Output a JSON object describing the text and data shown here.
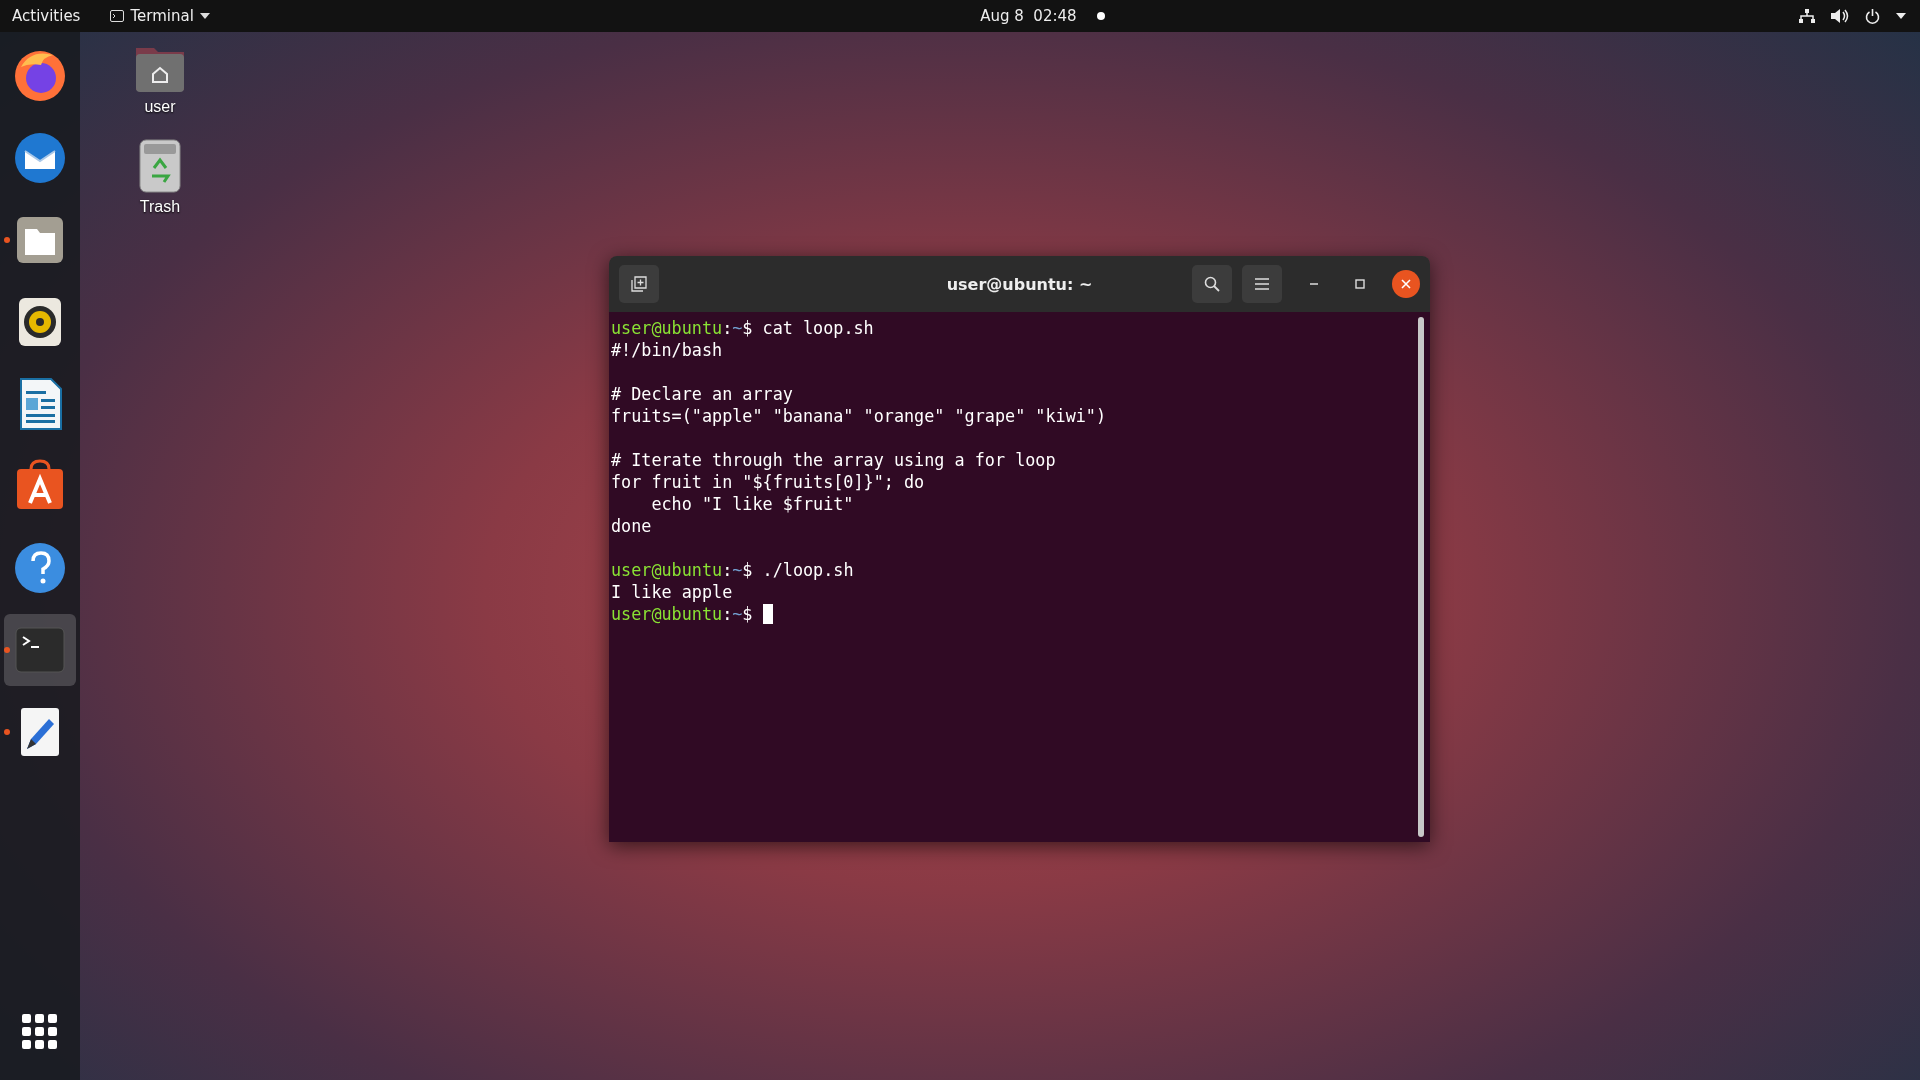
{
  "top_bar": {
    "activities": "Activities",
    "app_menu": "Terminal",
    "clock": "Aug 8  02:48",
    "recording": true
  },
  "dock": {
    "items": [
      {
        "kind": "browser",
        "running": false,
        "selected": false
      },
      {
        "kind": "mail",
        "running": false,
        "selected": false
      },
      {
        "kind": "files",
        "running": true,
        "selected": false
      },
      {
        "kind": "music",
        "running": false,
        "selected": false
      },
      {
        "kind": "document",
        "running": false,
        "selected": false
      },
      {
        "kind": "store",
        "running": false,
        "selected": false
      },
      {
        "kind": "help",
        "running": false,
        "selected": false
      },
      {
        "kind": "terminal",
        "running": true,
        "selected": true
      },
      {
        "kind": "editor",
        "running": true,
        "selected": false
      }
    ]
  },
  "desktop_icons": [
    {
      "kind": "home",
      "label": "user"
    },
    {
      "kind": "trash",
      "label": "Trash"
    }
  ],
  "terminal": {
    "title": "user@ubuntu: ~",
    "lines": [
      {
        "kind": "text",
        "parts": [
          {
            "text": "user@ubuntu",
            "color": "#8ae234"
          },
          {
            "text": ":",
            "color": "#ffffff"
          },
          {
            "text": "~",
            "color": "#729fcf"
          },
          {
            "text": "$ cat loop.sh",
            "color": "#ffffff"
          }
        ]
      },
      {
        "kind": "text",
        "parts": [
          {
            "text": "#!/bin/bash",
            "color": "#ffffff"
          }
        ]
      },
      {
        "kind": "blank"
      },
      {
        "kind": "text",
        "parts": [
          {
            "text": "# Declare an array",
            "color": "#ffffff"
          }
        ]
      },
      {
        "kind": "text",
        "parts": [
          {
            "text": "fruits=(\"apple\" \"banana\" \"orange\" \"grape\" \"kiwi\")",
            "color": "#ffffff"
          }
        ]
      },
      {
        "kind": "blank"
      },
      {
        "kind": "text",
        "parts": [
          {
            "text": "# Iterate through the array using a for loop",
            "color": "#ffffff"
          }
        ]
      },
      {
        "kind": "text",
        "parts": [
          {
            "text": "for fruit in \"${fruits[0]}\"; do",
            "color": "#ffffff"
          }
        ]
      },
      {
        "kind": "text",
        "parts": [
          {
            "text": "    echo \"I like $fruit\"",
            "color": "#ffffff"
          }
        ]
      },
      {
        "kind": "text",
        "parts": [
          {
            "text": "done",
            "color": "#ffffff"
          }
        ]
      },
      {
        "kind": "blank"
      },
      {
        "kind": "text",
        "parts": [
          {
            "text": "user@ubuntu",
            "color": "#8ae234"
          },
          {
            "text": ":",
            "color": "#ffffff"
          },
          {
            "text": "~",
            "color": "#729fcf"
          },
          {
            "text": "$ ./loop.sh",
            "color": "#ffffff"
          }
        ]
      },
      {
        "kind": "text",
        "parts": [
          {
            "text": "I like apple",
            "color": "#ffffff"
          }
        ]
      },
      {
        "kind": "text",
        "cursor": true,
        "parts": [
          {
            "text": "user@ubuntu",
            "color": "#8ae234"
          },
          {
            "text": ":",
            "color": "#ffffff"
          },
          {
            "text": "~",
            "color": "#729fcf"
          },
          {
            "text": "$ ",
            "color": "#ffffff"
          }
        ]
      }
    ]
  }
}
